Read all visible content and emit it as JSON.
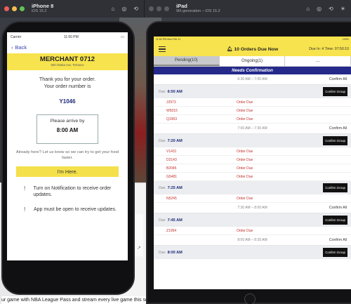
{
  "simulators": {
    "left": {
      "name": "iPhone 8",
      "os": "iOS 15.2"
    },
    "right": {
      "name": "iPad",
      "os": "9th generation – iOS 15.2"
    }
  },
  "desktop_caption": "ur game with NBA League Pass and stream every live game this seaso",
  "phone": {
    "status": {
      "carrier": "Carrier",
      "time": "11:50 PM"
    },
    "back_label": "Back",
    "merchant": {
      "name": "MERCHANT 0712",
      "address": "600 Alaska Ave, Torrance"
    },
    "thanks": [
      "Thank you for your order.",
      "Your order number is"
    ],
    "order_number": "Y1046",
    "arrive_by": {
      "label": "Please arrive by",
      "time": "8:00 AM"
    },
    "already_here": "Already here? Let us know so we can try to get your food faster.",
    "im_here_label": "I'm Here.",
    "notes": [
      "Turn on Notification to receive order updates.",
      "App must be open to receive updates."
    ]
  },
  "ipad": {
    "status": {
      "time": "11:50 PM  Mon Feb 21",
      "battery": "100%"
    },
    "header": {
      "title": "10 Orders Due Now",
      "due_in": "Due In: 4 Time: 07:50:10"
    },
    "tabs": [
      {
        "label": "Pending(10)",
        "active": true
      },
      {
        "label": "Ongoing(1)",
        "active": false
      },
      {
        "label": "...",
        "active": false
      }
    ],
    "banner": "Needs Confirmation",
    "confirm_all_label": "Confirm All",
    "confirm_group_label": "Confirm Group",
    "due_prefix": "Due:",
    "ranges": [
      {
        "range": "6:30 AM – 7:00 AM",
        "groups": [
          {
            "due": "6:50 AM",
            "orders": [
              {
                "id": "J2973",
                "status": "Order Due"
              },
              {
                "id": "W5015",
                "status": "Order Due"
              },
              {
                "id": "Q1963",
                "status": "Order Due"
              }
            ]
          }
        ]
      },
      {
        "range": "7:00 AM – 7:30 AM",
        "groups": [
          {
            "due": "7:20 AM",
            "orders": [
              {
                "id": "V1431",
                "status": "Order Due"
              },
              {
                "id": "D2143",
                "status": "Order Due"
              },
              {
                "id": "B2045",
                "status": "Order Due"
              },
              {
                "id": "G5481",
                "status": "Order Due"
              }
            ]
          },
          {
            "due": "7:25 AM",
            "orders": [
              {
                "id": "N5245",
                "status": "Order Due"
              }
            ]
          }
        ]
      },
      {
        "range": "7:30 AM – 8:00 AM",
        "groups": [
          {
            "due": "7:45 AM",
            "orders": [
              {
                "id": "Z1954",
                "status": "Order Due"
              }
            ]
          }
        ]
      },
      {
        "range": "8:00 AM – 8:30 AM",
        "groups": [
          {
            "due": "8:00 AM",
            "orders": []
          }
        ]
      }
    ]
  }
}
